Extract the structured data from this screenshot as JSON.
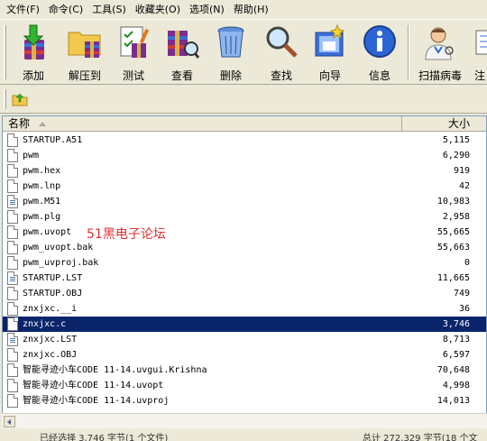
{
  "menu": [
    "文件(F)",
    "命令(C)",
    "工具(S)",
    "收藏夹(O)",
    "选项(N)",
    "帮助(H)"
  ],
  "toolbar": [
    {
      "label": "添加",
      "icon": "add-archive-icon"
    },
    {
      "label": "解压到",
      "icon": "extract-folder-icon"
    },
    {
      "label": "测试",
      "icon": "test-checklist-icon"
    },
    {
      "label": "查看",
      "icon": "view-books-icon"
    },
    {
      "label": "删除",
      "icon": "trash-can-icon"
    },
    {
      "label": "查找",
      "icon": "magnifier-icon"
    },
    {
      "label": "向导",
      "icon": "wizard-icon"
    },
    {
      "label": "信息",
      "icon": "info-icon"
    },
    {
      "label": "扫描病毒",
      "icon": "virus-scan-doctor-icon"
    },
    {
      "label": "注",
      "icon": "comment-icon"
    }
  ],
  "columns": {
    "name": "名称",
    "size": "大小"
  },
  "files": [
    {
      "name": "STARTUP.A51",
      "size": "5,115",
      "type": "plain"
    },
    {
      "name": "pwm",
      "size": "6,290",
      "type": "plain"
    },
    {
      "name": "pwm.hex",
      "size": "919",
      "type": "plain"
    },
    {
      "name": "pwm.lnp",
      "size": "42",
      "type": "plain"
    },
    {
      "name": "pwm.M51",
      "size": "10,983",
      "type": "doc"
    },
    {
      "name": "pwm.plg",
      "size": "2,958",
      "type": "plain"
    },
    {
      "name": "pwm.uvopt",
      "size": "55,665",
      "type": "plain"
    },
    {
      "name": "pwm_uvopt.bak",
      "size": "55,663",
      "type": "plain"
    },
    {
      "name": "pwm_uvproj.bak",
      "size": "0",
      "type": "plain"
    },
    {
      "name": "STARTUP.LST",
      "size": "11,665",
      "type": "doc"
    },
    {
      "name": "STARTUP.OBJ",
      "size": "749",
      "type": "plain"
    },
    {
      "name": "znxjxc.__i",
      "size": "36",
      "type": "plain"
    },
    {
      "name": "znxjxc.c",
      "size": "3,746",
      "type": "plain",
      "selected": true
    },
    {
      "name": "znxjxc.LST",
      "size": "8,713",
      "type": "doc"
    },
    {
      "name": "znxjxc.OBJ",
      "size": "6,597",
      "type": "plain"
    },
    {
      "name": "智能寻迹小车CODE 11-14.uvgui.Krishna",
      "size": "70,648",
      "type": "plain"
    },
    {
      "name": "智能寻迹小车CODE 11-14.uvopt",
      "size": "4,998",
      "type": "plain"
    },
    {
      "name": "智能寻迹小车CODE 11-14.uvproj",
      "size": "14,013",
      "type": "plain"
    }
  ],
  "watermark": "51黑电子论坛",
  "status": {
    "left": "已经选择 3,746 字节(1 个文件)",
    "right": "总计 272,329 字节(18 个文"
  }
}
